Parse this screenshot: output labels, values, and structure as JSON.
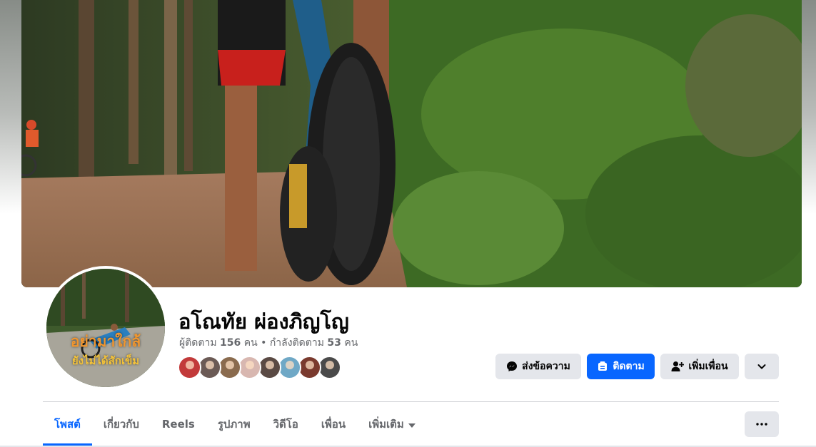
{
  "profile": {
    "name": "อโณทัย ผ่องภิญโญ",
    "followers_label": "ผู้ติดตาม",
    "followers_count": "156",
    "followers_unit": "คน",
    "separator": "•",
    "following_label": "กำลังติดตาม",
    "following_count": "53",
    "following_unit": "คน",
    "avatar_text_line1": "อย่ามาใกล้",
    "avatar_text_line2": "ยังไม่ได้สักเข็ม"
  },
  "friends": [
    {
      "color": "#c23a3a"
    },
    {
      "color": "#6b5a55"
    },
    {
      "color": "#8a6b4e"
    },
    {
      "color": "#d8b7b0"
    },
    {
      "color": "#5a4a44"
    },
    {
      "color": "#6fa8c6"
    },
    {
      "color": "#7a3a2e"
    },
    {
      "color": "#4a4a4a"
    }
  ],
  "actions": {
    "message": {
      "label": "ส่งข้อความ",
      "icon": "messenger-icon"
    },
    "follow": {
      "label": "ติดตาม",
      "icon": "follow-icon"
    },
    "add_friend": {
      "label": "เพิ่มเพื่อน",
      "icon": "add-friend-icon"
    },
    "more": {
      "icon": "chevron-down-icon"
    }
  },
  "tabs": [
    {
      "label": "โพสต์",
      "active": true
    },
    {
      "label": "เกี่ยวกับ",
      "active": false
    },
    {
      "label": "Reels",
      "active": false
    },
    {
      "label": "รูปภาพ",
      "active": false
    },
    {
      "label": "วิดีโอ",
      "active": false
    },
    {
      "label": "เพื่อน",
      "active": false
    },
    {
      "label": "เพิ่มเติม",
      "active": false,
      "icon": "caret-down-icon"
    }
  ],
  "tab_more_menu": {
    "icon": "ellipsis-icon"
  },
  "colors": {
    "accent": "#0866ff",
    "button_grey": "#e4e6eb",
    "text_secondary": "#65676b"
  }
}
